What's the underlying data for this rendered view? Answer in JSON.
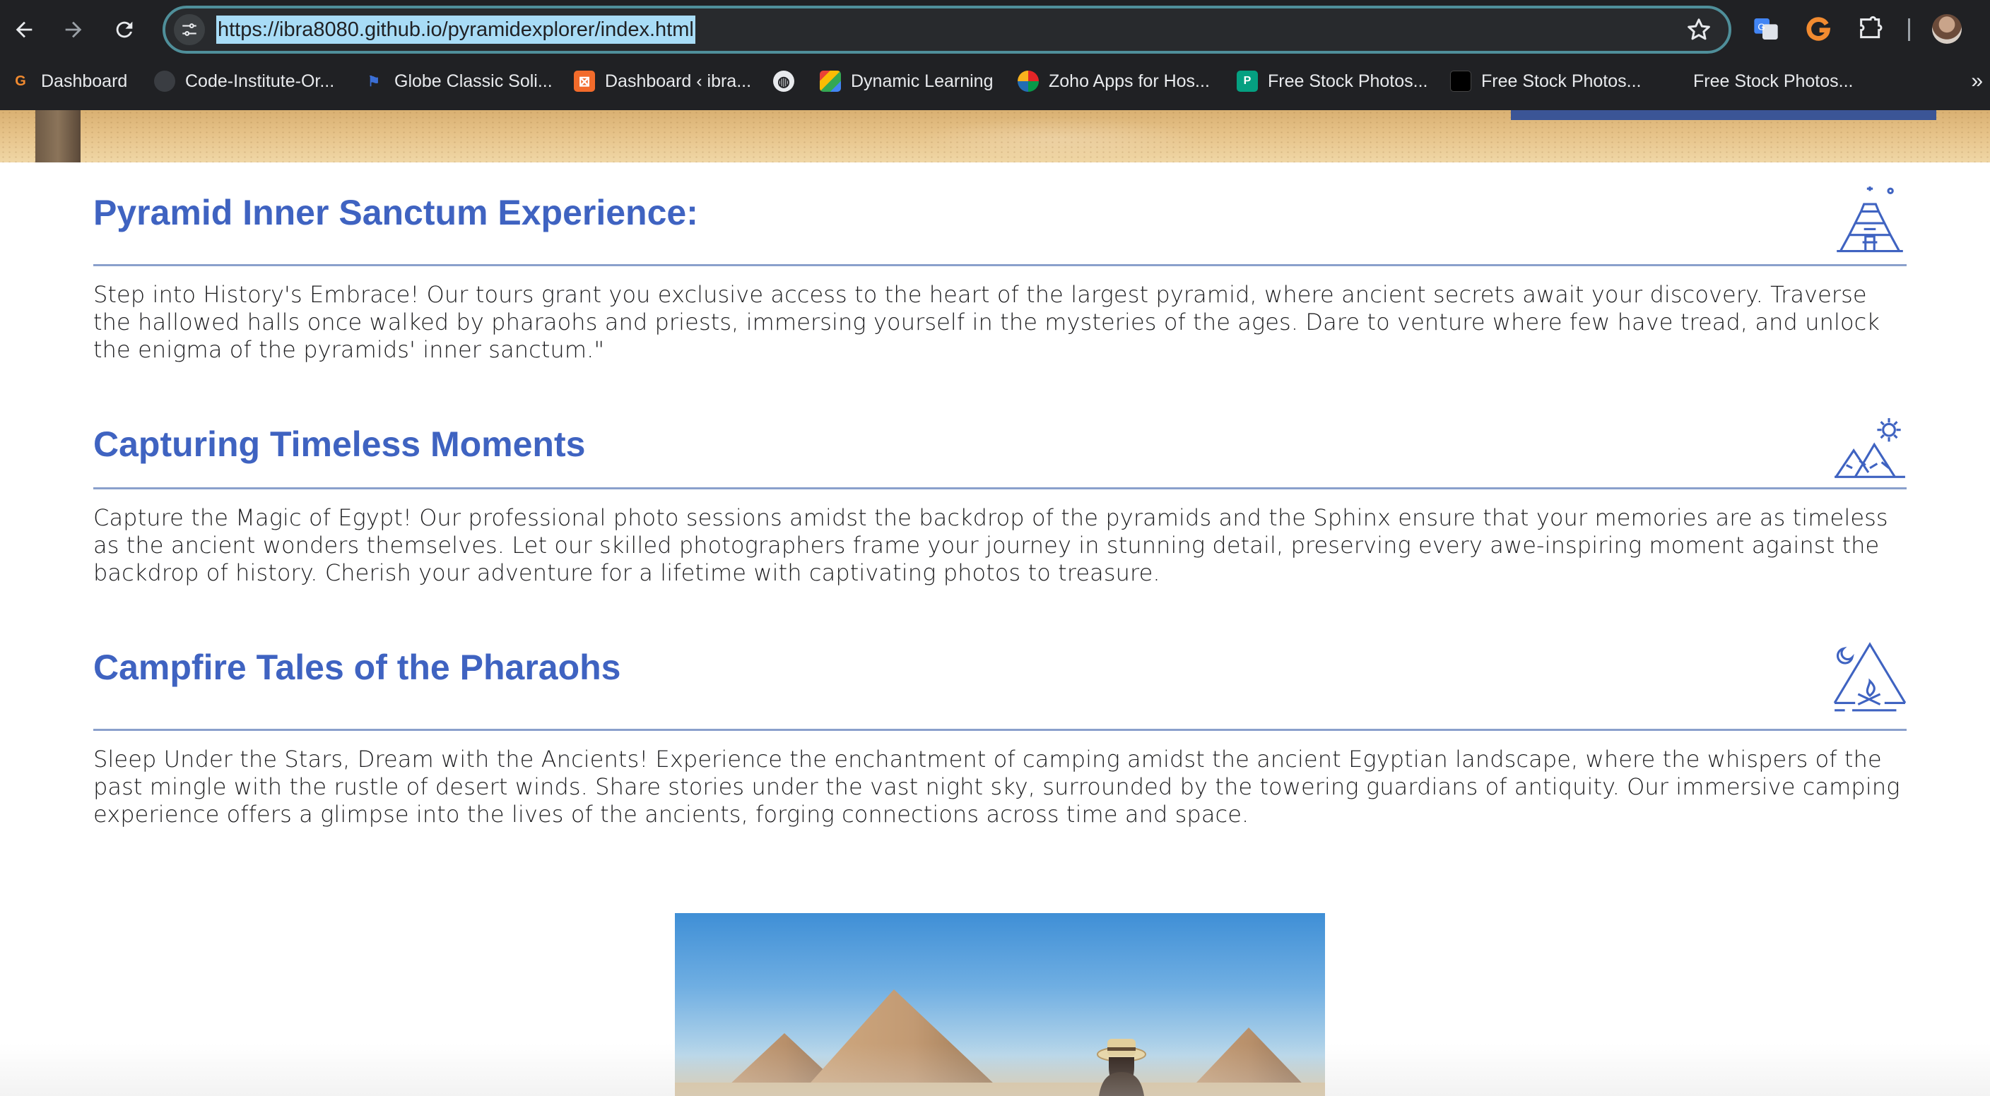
{
  "browser": {
    "url": "https://ibra8080.github.io/pyramidexplorer/index.html",
    "bookmarks": [
      {
        "label": "Dashboard",
        "icon": "g-logo-icon",
        "color": "#f28b30"
      },
      {
        "label": "Code-Institute-Or...",
        "icon": "github-icon",
        "color": "#24292e"
      },
      {
        "label": "Globe Classic Soli...",
        "icon": "flag-icon",
        "color": "#3b6fd6"
      },
      {
        "label": "Dashboard ‹ ibra...",
        "icon": "xampp-icon",
        "color": "#f26b2b"
      },
      {
        "label": "",
        "icon": "globe-icon",
        "color": "#e8eaed"
      },
      {
        "label": "Dynamic Learning",
        "icon": "dots-icon",
        "color": "#ffffff"
      },
      {
        "label": "Zoho Apps for Hos...",
        "icon": "zoho-icon",
        "color": "#e8eaed"
      },
      {
        "label": "Free Stock Photos...",
        "icon": "pexels-icon",
        "color": "#05a081"
      },
      {
        "label": "Free Stock Photos...",
        "icon": "unsplash-icon",
        "color": "#000000"
      },
      {
        "label": "Free Stock Photos...",
        "icon": "blank-icon",
        "color": "#202124"
      }
    ],
    "more_label": "»"
  },
  "sections": [
    {
      "title": "Pyramid Inner Sanctum Experience:",
      "icon": "step-pyramid-icon",
      "body": "Step into History's Embrace! Our tours grant you exclusive access to the heart of the largest pyramid, where ancient secrets await your discovery. Traverse the hallowed halls once walked by pharaohs and priests, immersing yourself in the mysteries of the ages. Dare to venture where few have tread, and unlock the enigma of the pyramids' inner sanctum.\""
    },
    {
      "title": "Capturing Timeless Moments",
      "icon": "pyramids-sun-icon",
      "body": "Capture the Magic of Egypt! Our professional photo sessions amidst the backdrop of the pyramids and the Sphinx ensure that your memories are as timeless as the ancient wonders themselves. Let our skilled photographers frame your journey in stunning detail, preserving every awe-inspiring moment against the backdrop of history. Cherish your adventure for a lifetime with captivating photos to treasure."
    },
    {
      "title": "Campfire Tales of the Pharaohs",
      "icon": "tent-campfire-icon",
      "body": "Sleep Under the Stars, Dream with the Ancients! Experience the enchantment of camping amidst the ancient Egyptian landscape, where the whispers of the past mingle with the rustle of desert winds. Share stories under the vast night sky, surrounded by the towering guardians of antiquity. Our immersive camping experience offers a glimpse into the lives of the ancients, forging connections across time and space."
    }
  ],
  "colors": {
    "accent": "#3f63c1",
    "rule": "#8aa0cc",
    "chrome_bg": "#202124"
  }
}
